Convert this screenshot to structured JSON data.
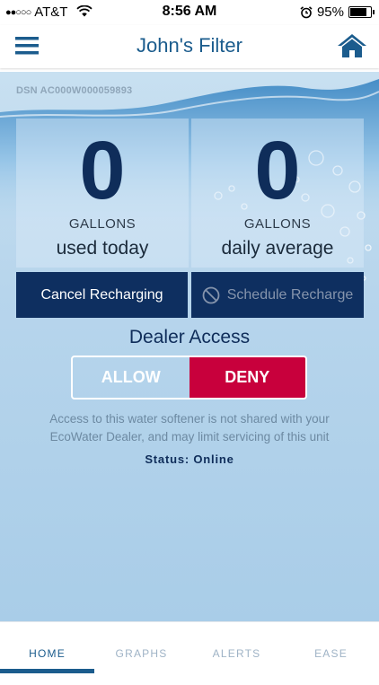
{
  "status_bar": {
    "signal_dots": "●●○○○",
    "carrier": "AT&T",
    "time": "8:56 AM",
    "battery_percent": "95%",
    "battery_level": 0.95
  },
  "header": {
    "title": "John's Filter",
    "menu_icon": "hamburger-icon",
    "home_icon": "home-icon"
  },
  "device": {
    "dsn": "DSN AC000W000059893"
  },
  "stats": [
    {
      "value": "0",
      "unit": "GALLONS",
      "label": "used today"
    },
    {
      "value": "0",
      "unit": "GALLONS",
      "label": "daily average"
    }
  ],
  "actions": {
    "cancel_recharging": "Cancel Recharging",
    "schedule_recharge": "Schedule Recharge"
  },
  "dealer_access": {
    "title": "Dealer Access",
    "allow_label": "ALLOW",
    "deny_label": "DENY",
    "selected": "DENY",
    "notice": "Access to this water softener is not shared with your EcoWater Dealer, and may limit servicing of this unit",
    "status": "Status: Online"
  },
  "tabs": [
    {
      "label": "HOME",
      "active": true
    },
    {
      "label": "GRAPHS",
      "active": false
    },
    {
      "label": "ALERTS",
      "active": false
    },
    {
      "label": "EASE",
      "active": false
    }
  ],
  "colors": {
    "primary_navy": "#0e2f60",
    "accent_blue": "#1b5c8d",
    "deny_red": "#c8003c"
  }
}
